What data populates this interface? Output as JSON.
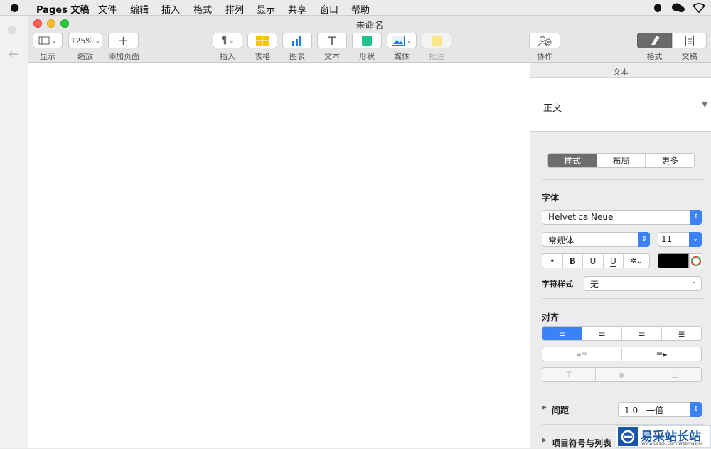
{
  "menubar": {
    "app": "Pages 文稿",
    "items": [
      "文件",
      "编辑",
      "插入",
      "格式",
      "排列",
      "显示",
      "共享",
      "窗口",
      "帮助"
    ]
  },
  "window": {
    "title": "未命名"
  },
  "toolbar": {
    "view": "显示",
    "zoom_value": "125%",
    "zoom": "缩放",
    "add_page": "添加页面",
    "insert": "插入",
    "table": "表格",
    "chart": "图表",
    "text": "文本",
    "shape": "形状",
    "media": "媒体",
    "comment": "批注",
    "collaborate": "协作",
    "format": "格式",
    "document": "文稿"
  },
  "panel": {
    "header": "文本",
    "paragraph_style": "正文",
    "tabs": [
      "样式",
      "布局",
      "更多"
    ],
    "font_label": "字体",
    "font_family": "Helvetica Neue",
    "font_style": "常规体",
    "font_size": "11",
    "format_buttons": [
      "•",
      "B",
      "U",
      "U"
    ],
    "char_style_label": "字符样式",
    "char_style_value": "无",
    "align_label": "对齐",
    "spacing_label": "间距",
    "spacing_value": "1.0 - 一倍",
    "bullets_label": "项目符号与列表",
    "text_color": "#000000",
    "accent": "#3b82f6"
  },
  "watermark": {
    "brand": "易采站长站",
    "sub": "Www.Easck.Com Webmaster"
  }
}
